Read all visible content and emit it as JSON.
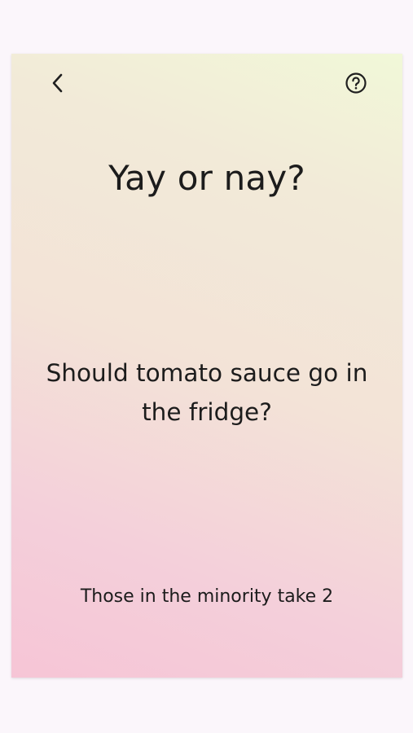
{
  "card": {
    "title": "Yay or nay?",
    "question": "Should tomato sauce go in the fridge?",
    "rule": "Those in the minority take 2"
  },
  "icons": {
    "back": "chevron-left-icon",
    "help": "question-circle-icon"
  },
  "colors": {
    "background": "#fbf6fb",
    "gradient_top": "#f1f8d8",
    "gradient_bottom": "#f6c5d6",
    "text": "#1c1c1c"
  }
}
